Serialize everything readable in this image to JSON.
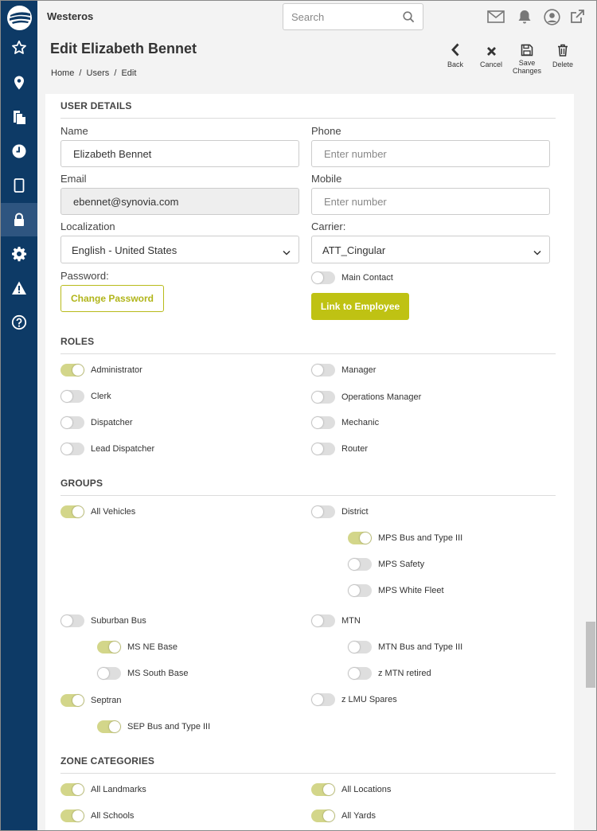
{
  "app": {
    "title": "Westeros"
  },
  "search": {
    "placeholder": "Search"
  },
  "header": {
    "title": "Edit Elizabeth Bennet",
    "breadcrumb": [
      "Home",
      "/",
      "Users",
      "/",
      "Edit"
    ],
    "actions": {
      "back": "Back",
      "cancel": "Cancel",
      "save_line1": "Save",
      "save_line2": "Changes",
      "delete": "Delete"
    }
  },
  "sidebar": {
    "icons": [
      "logo-icon",
      "star-icon",
      "map-pin-icon",
      "documents-icon",
      "clock-icon",
      "tablet-icon",
      "lock-icon",
      "gear-icon",
      "warning-icon",
      "help-icon"
    ],
    "active": "lock-icon"
  },
  "topbar_icons": [
    "mail-icon",
    "bell-icon",
    "user-circle-icon",
    "external-link-icon"
  ],
  "user_details": {
    "title": "USER DETAILS",
    "name_label": "Name",
    "name_value": "Elizabeth Bennet",
    "phone_label": "Phone",
    "phone_placeholder": "Enter number",
    "email_label": "Email",
    "email_value": "ebennet@synovia.com",
    "mobile_label": "Mobile",
    "mobile_placeholder": "Enter number",
    "localization_label": "Localization",
    "localization_value": "English - United States",
    "carrier_label": "Carrier:",
    "carrier_value": "ATT_Cingular",
    "password_label": "Password:",
    "change_password": "Change Password",
    "main_contact_label": "Main Contact",
    "main_contact_on": false,
    "link_employee": "Link to Employee"
  },
  "roles": {
    "title": "ROLES",
    "items": [
      {
        "label": "Administrator",
        "on": true
      },
      {
        "label": "Manager",
        "on": false
      },
      {
        "label": "Clerk",
        "on": false
      },
      {
        "label": "Operations Manager",
        "on": false
      },
      {
        "label": "Dispatcher",
        "on": false
      },
      {
        "label": "Mechanic",
        "on": false
      },
      {
        "label": "Lead Dispatcher",
        "on": false
      },
      {
        "label": "Router",
        "on": false
      }
    ]
  },
  "groups": {
    "title": "GROUPS",
    "items": [
      {
        "label": "All Vehicles",
        "on": true
      },
      {
        "label": "District",
        "on": false
      },
      {
        "label": "MPS Bus and Type III",
        "on": true
      },
      {
        "label": "MPS Safety",
        "on": false
      },
      {
        "label": "MPS White Fleet",
        "on": false
      },
      {
        "label": "Suburban Bus",
        "on": false
      },
      {
        "label": "MTN",
        "on": false
      },
      {
        "label": "MS NE Base",
        "on": true
      },
      {
        "label": "MTN Bus and Type III",
        "on": false
      },
      {
        "label": "MS South Base",
        "on": false
      },
      {
        "label": "z MTN retired",
        "on": false
      },
      {
        "label": "Septran",
        "on": true
      },
      {
        "label": "z LMU Spares",
        "on": false
      },
      {
        "label": "SEP Bus and Type III",
        "on": true
      }
    ]
  },
  "zone_categories": {
    "title": "ZONE CATEGORIES",
    "items": [
      {
        "label": "All Landmarks",
        "on": true
      },
      {
        "label": "All Locations",
        "on": true
      },
      {
        "label": "All Schools",
        "on": true
      },
      {
        "label": "All Yards",
        "on": true
      }
    ]
  },
  "colors": {
    "sidebar": "#0d3a66",
    "accent": "#bfc213",
    "toggle_on": "#d3d68a",
    "toggle_off": "#dedede"
  }
}
